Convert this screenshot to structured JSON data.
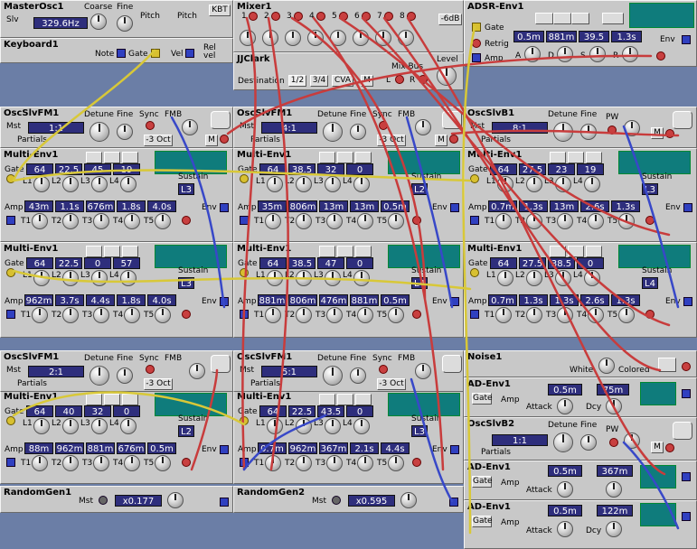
{
  "master": {
    "title": "MasterOsc1",
    "slv": "Slv",
    "freq": "329.6Hz",
    "coarse": "Coarse",
    "fine": "Fine",
    "pitch1": "Pitch",
    "pitch2": "Pitch",
    "kbt": "KBT"
  },
  "keyboard": {
    "title": "Keyboard1",
    "note": "Note",
    "gate": "Gate",
    "vel": "Vel",
    "relvel": "Rel vel"
  },
  "mixer": {
    "title": "Mixer1",
    "inputs": [
      "1",
      "2",
      "3",
      "4",
      "5",
      "6",
      "7",
      "8"
    ],
    "db": "-6dB"
  },
  "jjclark": {
    "title": "JJClark",
    "destination": "Destination",
    "opt1": "1/2",
    "opt2": "3/4",
    "opt3": "CVA",
    "m": "M",
    "mixbus": "Mix Bus",
    "level": "Level",
    "l": "L",
    "r": "R"
  },
  "adsr": {
    "title": "ADSR-Env1",
    "gate": "Gate",
    "retrig": "Retrig",
    "amp": "Amp",
    "a": "A",
    "d": "D",
    "s": "S",
    "r": "R",
    "env": "Env",
    "vals": [
      "0.5m",
      "881m",
      "39.5",
      "1.3s"
    ]
  },
  "osc1": {
    "title": "OscSlvFM1",
    "mst": "Mst",
    "detune": "Detune",
    "fine": "Fine",
    "sync": "Sync",
    "fmb": "FMB",
    "ratio": "1:1",
    "partials": "Partials",
    "oct": "-3 Oct",
    "m": "M"
  },
  "osc2": {
    "title": "OscSlvFM1",
    "mst": "Mst",
    "detune": "Detune",
    "fine": "Fine",
    "sync": "Sync",
    "fmb": "FMB",
    "ratio": "4:1",
    "partials": "Partials",
    "oct": "-3 Oct",
    "m": "M"
  },
  "osc3": {
    "title": "OscSlvB1",
    "mst": "Mst",
    "detune": "Detune",
    "fine": "Fine",
    "pw": "PW",
    "ratio": "8:1",
    "partials": "Partials",
    "m": "M"
  },
  "env_row1": [
    {
      "title": "Multi-Env1",
      "levels": [
        "64",
        "22.5",
        "45",
        "19"
      ],
      "times": [
        "43m",
        "1.1s",
        "676m",
        "1.8s",
        "4.0s"
      ],
      "sustain": "L3"
    },
    {
      "title": "Multi-Env1",
      "levels": [
        "64",
        "38.5",
        "32",
        "0"
      ],
      "times": [
        "35m",
        "806m",
        "13m",
        "13m",
        "0.5m"
      ],
      "sustain": "L2"
    },
    {
      "title": "Multi-Env1",
      "levels": [
        "64",
        "27.5",
        "23",
        "19"
      ],
      "times": [
        "0.7m",
        "1.3s",
        "13m",
        "2.6s",
        "1.3s"
      ],
      "sustain": "L3"
    }
  ],
  "env_row2": [
    {
      "title": "Multi-Env1",
      "levels": [
        "64",
        "22.5",
        "0",
        "57"
      ],
      "times": [
        "962m",
        "3.7s",
        "4.4s",
        "1.8s",
        "4.0s"
      ],
      "sustain": "L3"
    },
    {
      "title": "Multi-Env1",
      "levels": [
        "64",
        "38.5",
        "47",
        "0"
      ],
      "times": [
        "881m",
        "806m",
        "476m",
        "881m",
        "0.5m"
      ],
      "sustain": "L4"
    },
    {
      "title": "Multi-Env1",
      "levels": [
        "64",
        "27.5",
        "38.5",
        "0"
      ],
      "times": [
        "0.7m",
        "1.3s",
        "1.3s",
        "2.6s",
        "1.3s"
      ],
      "sustain": "L4"
    }
  ],
  "env_labels": {
    "gate": "Gate",
    "amp": "Amp",
    "env": "Env",
    "sustain": "Sustain",
    "l": [
      "L1",
      "L2",
      "L3",
      "L4"
    ],
    "t": [
      "T1",
      "T2",
      "T3",
      "T4",
      "T5"
    ]
  },
  "osc4": {
    "title": "OscSlvFM1",
    "mst": "Mst",
    "detune": "Detune",
    "fine": "Fine",
    "sync": "Sync",
    "fmb": "FMB",
    "ratio": "2:1",
    "partials": "Partials",
    "oct": "-3 Oct"
  },
  "osc5": {
    "title": "OscSlvFM1",
    "mst": "Mst",
    "detune": "Detune",
    "fine": "Fine",
    "sync": "Sync",
    "fmb": "FMB",
    "ratio": "5:1",
    "partials": "Partials",
    "oct": "-3 Oct"
  },
  "env_row3": [
    {
      "title": "Multi-Env1",
      "levels": [
        "64",
        "40",
        "32",
        "0"
      ],
      "times": [
        "88m",
        "962m",
        "881m",
        "676m",
        "0.5m"
      ],
      "sustain": "L2"
    },
    {
      "title": "Multi-Env1",
      "levels": [
        "64",
        "22.5",
        "43.5",
        "0"
      ],
      "times": [
        "0.7m",
        "962m",
        "367m",
        "2.1s",
        "4.4s"
      ],
      "sustain": "L3"
    }
  ],
  "rand1": {
    "title": "RandomGen1",
    "mst": "Mst",
    "val": "x0.177"
  },
  "rand2": {
    "title": "RandomGen2",
    "mst": "Mst",
    "val": "x0.595"
  },
  "noise": {
    "title": "Noise1",
    "white": "White",
    "colored": "Colored"
  },
  "adenv1": {
    "title": "AD-Env1",
    "gate": "Gate",
    "amp": "Amp",
    "attack": "Attack",
    "dcy": "Dcy",
    "a": "0.5m",
    "d": "75m"
  },
  "oscb2": {
    "title": "OscSlvB2",
    "detune": "Detune",
    "fine": "Fine",
    "pw": "PW",
    "ratio": "1:1",
    "partials": "Partials",
    "m": "M"
  },
  "adenv2": {
    "title": "AD-Env1",
    "gate": "Gate",
    "amp": "Amp",
    "attack": "Attack",
    "a": "0.5m",
    "d": "367m"
  },
  "adenv3": {
    "title": "AD-Env1",
    "gate": "Gate",
    "amp": "Amp",
    "attack": "Attack",
    "dcy": "Dcy",
    "a": "0.5m",
    "d": "122m"
  },
  "colors": {
    "panel": "#c8c8c8",
    "background": "#6b7ea6",
    "display": "#2e2e7c",
    "scope": "#0f7c7c",
    "cable_red": "#c83c3c",
    "cable_yellow": "#d8c838",
    "cable_blue": "#3848c8"
  }
}
